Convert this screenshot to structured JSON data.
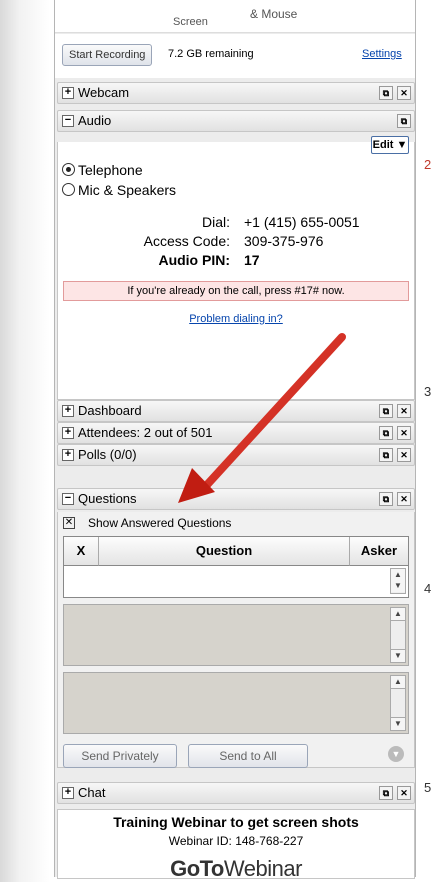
{
  "recording": {
    "screen_label": "Screen",
    "mouse_label": "& Mouse",
    "start_button": "Start Recording",
    "remaining": "7.2 GB remaining",
    "settings_link": "Settings"
  },
  "sections": {
    "webcam": "Webcam",
    "audio": "Audio",
    "dashboard": "Dashboard",
    "attendees": "Attendees:  2 out of 501",
    "polls": "Polls (0/0)",
    "questions": "Questions",
    "chat": "Chat"
  },
  "audio": {
    "edit_button": "Edit ▼",
    "options": [
      "Telephone",
      "Mic & Speakers"
    ],
    "selected": "Telephone",
    "dial_label": "Dial:",
    "dial_value": "+1 (415) 655-0051",
    "access_label": "Access Code:",
    "access_value": "309-375-976",
    "pin_label": "Audio PIN:",
    "pin_value": "17",
    "pin_note": "If you're already on the call, press #17# now.",
    "problem_link": "Problem dialing in?"
  },
  "questions": {
    "show_answered": "Show Answered Questions",
    "columns": [
      "X",
      "Question",
      "Asker"
    ],
    "send_privately": "Send Privately",
    "send_to_all": "Send to All"
  },
  "footer": {
    "title": "Training Webinar to get screen shots",
    "webinar_id": "Webinar ID: 148-768-227",
    "logo_bold": "GoTo",
    "logo_light": "Webinar"
  },
  "right_margin": [
    "2",
    "3",
    "4",
    "5"
  ],
  "colors": {
    "arrow": "#d62a1e",
    "link": "#0645ad",
    "pin_note_bg": "#fde5e5"
  }
}
